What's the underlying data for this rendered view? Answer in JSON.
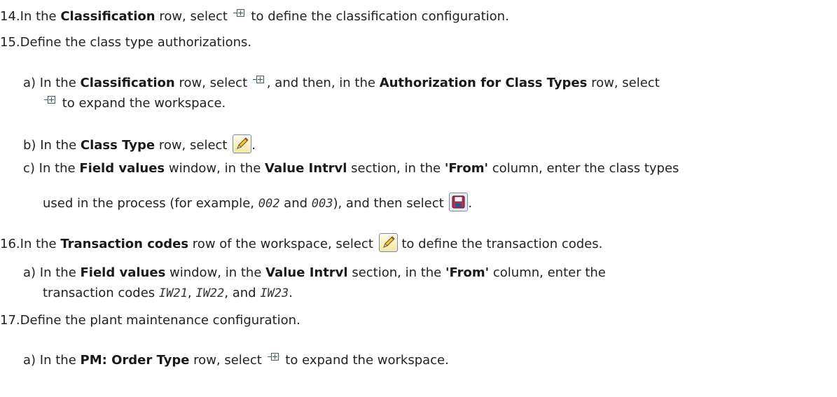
{
  "steps": {
    "s14": {
      "num": "14.",
      "pre": "In the ",
      "row": "Classification",
      "post": " row, select ",
      "tail": " to define the classification configuration.",
      "icon": "expand-node-icon"
    },
    "s15": {
      "num": "15.",
      "text": "Define the class type authorizations.",
      "a": {
        "label": "a)",
        "p1": "In the ",
        "b1": "Classification",
        "p2": " row, select ",
        "p3": ", and then, in the ",
        "b2": "Authorization for Class Types",
        "p4": " row, select",
        "p5": " to expand the workspace."
      },
      "b": {
        "label": "b)",
        "p1": "In the ",
        "b1": "Class Type",
        "p2": " row, select ",
        "p3": ".",
        "icon": "pencil-icon"
      },
      "c": {
        "label": "c)",
        "p1": "In the ",
        "b1": "Field values",
        "p2": " window, in the ",
        "b2": "Value Intrvl",
        "p3": " section, in the ",
        "b3": "'From'",
        "p4": " column, enter the class types",
        "p5": "used in the process (for example, ",
        "code1": "002",
        "p6": " and ",
        "code2": "003",
        "p7": "), and then select ",
        "p8": ".",
        "icon": "save-icon"
      }
    },
    "s16": {
      "num": "16.",
      "pre": "In the ",
      "row": "Transaction codes",
      "post": " row of the workspace, select ",
      "tail": " to define the transaction codes.",
      "a": {
        "label": "a)",
        "p1": "In the ",
        "b1": "Field values",
        "p2": " window, in the ",
        "b2": "Value Intrvl",
        "p3": " section, in the ",
        "b3": "'From'",
        "p4": " column, enter the",
        "p5": "transaction codes ",
        "code1": "IW21",
        "p6": ", ",
        "code2": "IW22",
        "p7": ", and ",
        "code3": "IW23",
        "p8": "."
      }
    },
    "s17": {
      "num": "17.",
      "text": "Define the plant maintenance configuration.",
      "a": {
        "label": "a)",
        "p1": "In the ",
        "b1": "PM: Order Type",
        "p2": " row, select ",
        "p3": " to expand the workspace."
      }
    }
  },
  "colors": {
    "text": "#222222",
    "icon_blue": "#3a5a88",
    "pencil_yellow": "#f4e7a4"
  }
}
